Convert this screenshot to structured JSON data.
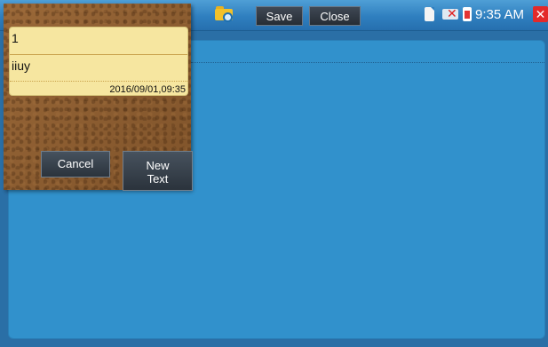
{
  "toolbar": {
    "app_icon": "notepad-icon",
    "folder_icon": "folder-search-icon",
    "save_label": "Save",
    "close_label": "Close"
  },
  "status": {
    "sd_icon": "sd-card-icon",
    "usb_icon": "usb-disconnected-icon",
    "battery_icon": "battery-low-icon",
    "time": "9:35 AM",
    "power_icon": "power-off-icon"
  },
  "note": {
    "title": "1",
    "body": "iiuy",
    "date": "2016/09/01,09:35"
  },
  "popup": {
    "cancel_label": "Cancel",
    "new_text_label": "New\nText"
  },
  "colors": {
    "topbar": "#2f7fbf",
    "panel": "#3191cc",
    "note_card": "#f6e6a0",
    "cork": "#8a5b2e"
  }
}
